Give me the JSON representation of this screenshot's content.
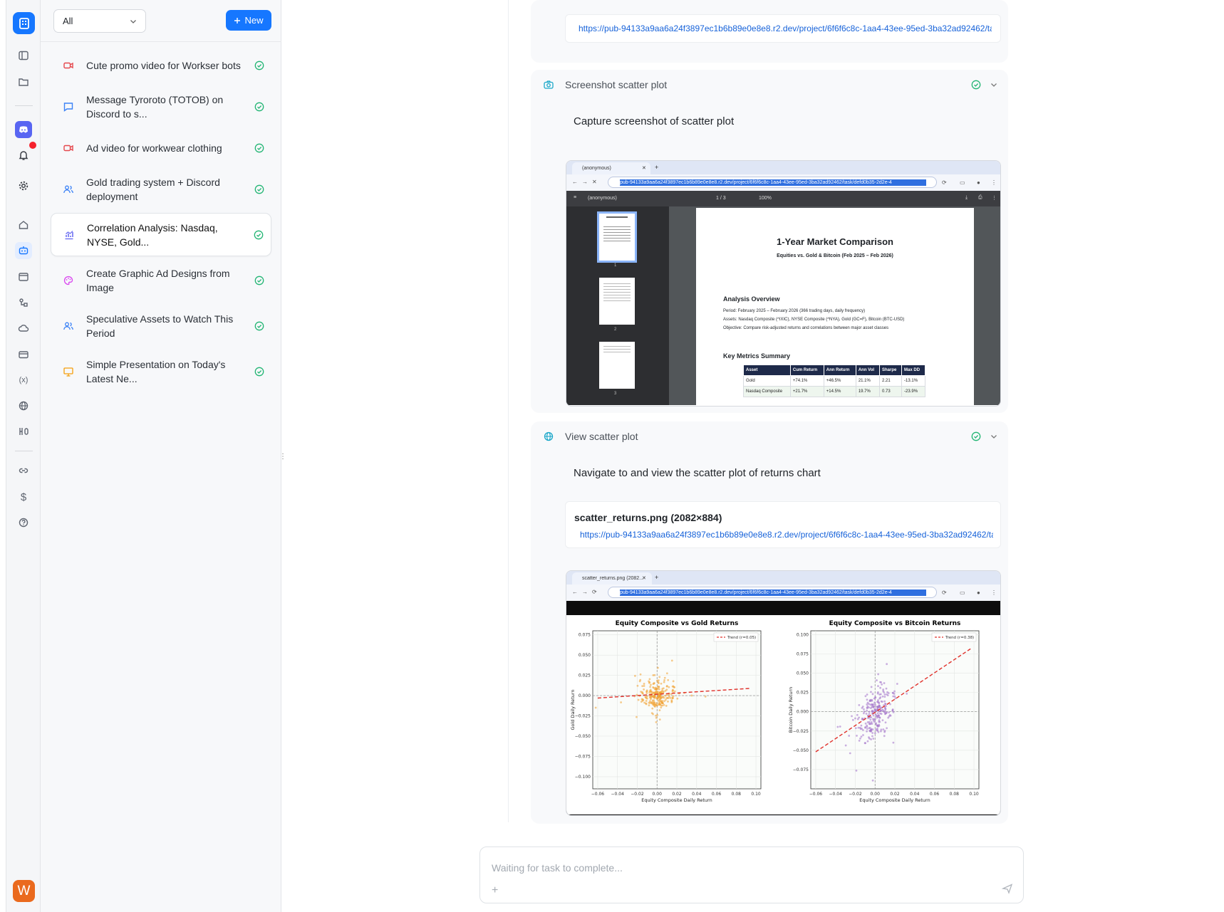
{
  "sidebar_filter": {
    "selected": "All"
  },
  "new_button": {
    "label": "New"
  },
  "tasks": [
    {
      "title": "Cute promo video for Workser bots",
      "icon": "video-icon",
      "color": "#e5484d"
    },
    {
      "title": "Message Tyroroto (TOTOB) on Discord to s...",
      "icon": "chat-icon",
      "color": "#3b82f6"
    },
    {
      "title": "Ad video for workwear clothing",
      "icon": "video-icon",
      "color": "#e5484d"
    },
    {
      "title": "Gold trading system + Discord deployment",
      "icon": "users-icon",
      "color": "#3b82f6"
    },
    {
      "title": "Correlation Analysis: Nasdaq, NYSE, Gold...",
      "icon": "chart-icon",
      "color": "#6366f1"
    },
    {
      "title": "Create Graphic Ad Designs from Image",
      "icon": "palette-icon",
      "color": "#d946ef"
    },
    {
      "title": "Speculative Assets to Watch This Period",
      "icon": "users-icon",
      "color": "#3b82f6"
    },
    {
      "title": "Simple Presentation on Today's Latest Ne...",
      "icon": "presentation-icon",
      "color": "#f59e0b"
    }
  ],
  "top_link": {
    "url": "https://pub-94133a9aa6a24f3897ec1b6b89e0e8e8.r2.dev/project/6f6f6c8c-1aa4-43ee-95ed-3ba32ad92462/task/defd0b35-2d2e-4"
  },
  "step1": {
    "title": "Screenshot scatter plot",
    "description": "Capture screenshot of scatter plot",
    "browser": {
      "tab": "(anonymous)",
      "address": "pub-94133a9aa6a24f3897ec1b6b89e0e8e8.r2.dev/project/6f6f6c8c-1aa4-43ee-95ed-3ba32ad92462/task/defd0b35-2d2e-4",
      "pdf_title": "(anonymous)",
      "pdf_pages": "1 / 3",
      "zoom": "100%",
      "thumb_numbers": [
        "1",
        "2",
        "3"
      ]
    },
    "doc": {
      "title": "1-Year Market Comparison",
      "subtitle": "Equities vs. Gold & Bitcoin (Feb 2025 – Feb 2026)",
      "overview_heading": "Analysis Overview",
      "overview_lines": [
        "Period: February 2025 – February 2026 (366 trading days, daily frequency)",
        "Assets: Nasdaq Composite (^IXIC), NYSE Composite (^NYA), Gold (GC=F), Bitcoin (BTC-USD)",
        "Objective: Compare risk-adjusted returns and correlations between major asset classes"
      ],
      "metrics_heading": "Key Metrics Summary",
      "metrics_columns": [
        "Asset",
        "Cum Return",
        "Ann Return",
        "Ann Vol",
        "Sharpe",
        "Max DD"
      ],
      "metrics_rows": [
        [
          "Gold",
          "+74.1%",
          "+46.5%",
          "21.1%",
          "2.21",
          "-13.1%"
        ],
        [
          "Nasdaq Composite",
          "+21.7%",
          "+14.5%",
          "19.7%",
          "0.73",
          "-23.9%"
        ]
      ]
    }
  },
  "step2": {
    "title": "View scatter plot",
    "description": "Navigate to and view the scatter plot of returns chart",
    "file_label": "scatter_returns.png (2082×884)",
    "url": "https://pub-94133a9aa6a24f3897ec1b6b89e0e8e8.r2.dev/project/6f6f6c8c-1aa4-43ee-95ed-3ba32ad92462/task/defd0b35-2d2e-4",
    "browser": {
      "tab": "scatter_returns.png (2082...",
      "address": "pub-94133a9aa6a24f3897ec1b6b89e0e8e8.r2.dev/project/6f6f6c8c-1aa4-43ee-95ed-3ba32ad92462/task/defd0b35-2d2e-4"
    }
  },
  "chart_data": [
    {
      "type": "scatter",
      "title": "Equity Composite vs Gold Returns",
      "xlabel": "Equity Composite Daily Return",
      "ylabel": "Gold Daily Return",
      "xlim": [
        -0.065,
        0.105
      ],
      "ylim": [
        -0.115,
        0.08
      ],
      "xticks": [
        "−0.06",
        "−0.04",
        "−0.02",
        "0.00",
        "0.02",
        "0.04",
        "0.06",
        "0.08",
        "0.10"
      ],
      "yticks": [
        "0.075",
        "0.050",
        "0.025",
        "0.000",
        "−0.025",
        "−0.050",
        "−0.075",
        "−0.100"
      ],
      "legend": "Trend (r=0.05)",
      "legend_position": "top-right",
      "point_color": "#f0a030",
      "trend": [
        [
          -0.06,
          -0.003
        ],
        [
          0.095,
          0.009
        ]
      ],
      "grid": true
    },
    {
      "type": "scatter",
      "title": "Equity Composite vs Bitcoin Returns",
      "xlabel": "Equity Composite Daily Return",
      "ylabel": "Bitcoin Daily Return",
      "xlim": [
        -0.065,
        0.105
      ],
      "ylim": [
        -0.1,
        0.105
      ],
      "xticks": [
        "−0.06",
        "−0.04",
        "−0.02",
        "0.00",
        "0.02",
        "0.04",
        "0.06",
        "0.08",
        "0.10"
      ],
      "yticks": [
        "0.100",
        "0.075",
        "0.050",
        "0.025",
        "0.000",
        "−0.025",
        "−0.050",
        "−0.075"
      ],
      "legend": "Trend (r=0.38)",
      "legend_position": "top-right",
      "point_color": "#a070c8",
      "trend": [
        [
          -0.06,
          -0.052
        ],
        [
          0.097,
          0.082
        ]
      ],
      "grid": true
    }
  ],
  "input": {
    "placeholder": "Waiting for task to complete..."
  }
}
